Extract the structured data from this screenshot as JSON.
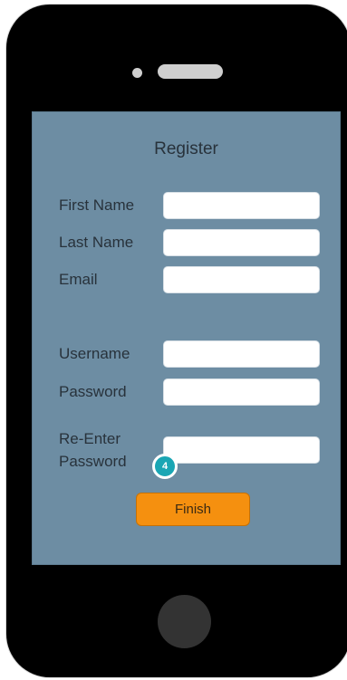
{
  "form": {
    "title": "Register",
    "fields": [
      {
        "label": "First Name",
        "value": ""
      },
      {
        "label": "Last Name",
        "value": ""
      },
      {
        "label": "Email",
        "value": ""
      },
      {
        "label": "Username",
        "value": ""
      },
      {
        "label": "Password",
        "value": ""
      },
      {
        "label_line1": "Re-Enter",
        "label_line2": "Password",
        "value": ""
      }
    ],
    "finish_label": "Finish"
  },
  "annotation": {
    "badge": "4"
  },
  "colors": {
    "screen_bg": "#6d8da3",
    "button_accent": "#f5900f",
    "badge": "#1aa6b4",
    "phone_body": "#000000"
  }
}
